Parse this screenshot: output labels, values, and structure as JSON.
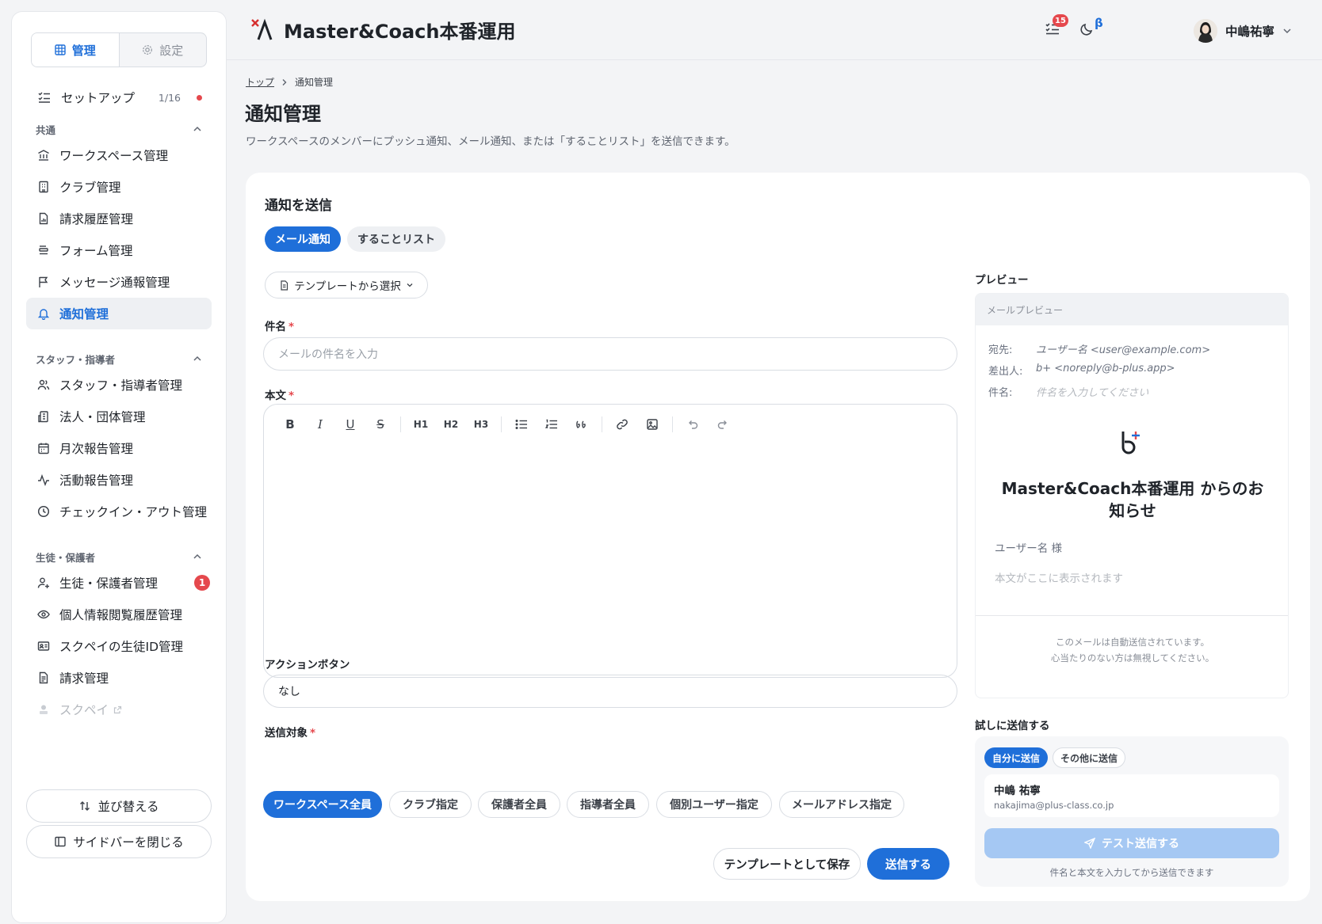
{
  "sidebar": {
    "tabs": [
      {
        "label": "管理",
        "icon": "grid-icon"
      },
      {
        "label": "設定",
        "icon": "gear-icon"
      }
    ],
    "setup": {
      "label": "セットアップ",
      "count": "1/16"
    },
    "sections": [
      {
        "title": "共通",
        "items": [
          {
            "label": "ワークスペース管理",
            "icon": "building-icon"
          },
          {
            "label": "クラブ管理",
            "icon": "office-icon"
          },
          {
            "label": "請求履歴管理",
            "icon": "receipt-icon"
          },
          {
            "label": "フォーム管理",
            "icon": "form-icon"
          },
          {
            "label": "メッセージ通報管理",
            "icon": "flag-icon"
          },
          {
            "label": "通知管理",
            "icon": "bell-icon"
          }
        ]
      },
      {
        "title": "スタッフ・指導者",
        "items": [
          {
            "label": "スタッフ・指導者管理",
            "icon": "users-icon"
          },
          {
            "label": "法人・団体管理",
            "icon": "company-icon"
          },
          {
            "label": "月次報告管理",
            "icon": "calendar-icon"
          },
          {
            "label": "活動報告管理",
            "icon": "activity-icon"
          },
          {
            "label": "チェックイン・アウト管理",
            "icon": "clock-icon"
          }
        ]
      },
      {
        "title": "生徒・保護者",
        "items": [
          {
            "label": "生徒・保護者管理",
            "icon": "user-plus-icon",
            "badge": "1"
          },
          {
            "label": "個人情報閲覧履歴管理",
            "icon": "eye-icon"
          },
          {
            "label": "スクペイの生徒ID管理",
            "icon": "id-card-icon"
          },
          {
            "label": "請求管理",
            "icon": "invoice-icon"
          },
          {
            "label": "スクペイ",
            "icon": "external-link-icon"
          }
        ]
      }
    ],
    "reorder_label": "並び替える",
    "close_label": "サイドバーを閉じる"
  },
  "header": {
    "app_name": "Master&Coach本番運用",
    "task_count": "15",
    "theme_badge": "β",
    "user_name": "中嶋祐寧"
  },
  "breadcrumb": {
    "home": "トップ",
    "current": "通知管理"
  },
  "page": {
    "title": "通知管理",
    "description": "ワークスペースのメンバーにプッシュ通知、メール通知、または「することリスト」を送信できます。"
  },
  "form": {
    "card_title": "通知を送信",
    "tabs": [
      "メール通知",
      "することリスト"
    ],
    "template_button": "テンプレートから選択",
    "subject_label": "件名",
    "subject_placeholder": "メールの件名を入力",
    "body_label": "本文",
    "toolbar": [
      "B",
      "I",
      "U",
      "S",
      "H1",
      "H2",
      "H3"
    ],
    "action_label": "アクションボタン",
    "action_value": "なし",
    "target_label": "送信対象",
    "targets": [
      "ワークスペース全員",
      "クラブ指定",
      "保護者全員",
      "指導者全員",
      "個別ユーザー指定",
      "メールアドレス指定"
    ],
    "save_template": "テンプレートとして保存",
    "send": "送信する"
  },
  "preview": {
    "label": "プレビュー",
    "header": "メールプレビュー",
    "to_key": "宛先:",
    "to_val": "ユーザー名 <user@example.com>",
    "from_key": "差出人:",
    "from_val": "b+ <noreply@b-plus.app>",
    "subject_key": "件名:",
    "subject_val": "件名を入力してください",
    "mail_title": "Master&Coach本番運用 からのお知らせ",
    "greeting": "ユーザー名 様",
    "body_placeholder": "本文がここに表示されます",
    "footer_line1": "このメールは自動送信されています。",
    "footer_line2": "心当たりのない方は無視してください。"
  },
  "test_send": {
    "label": "試しに送信する",
    "tabs": [
      "自分に送信",
      "その他に送信"
    ],
    "name": "中嶋 祐寧",
    "email": "nakajima@plus-class.co.jp",
    "button": "テスト送信する",
    "note": "件名と本文を入力してから送信できます"
  },
  "colors": {
    "accent": "#1f6fd9",
    "danger": "#e5484d",
    "disabled_button": "#a5c8f3"
  }
}
